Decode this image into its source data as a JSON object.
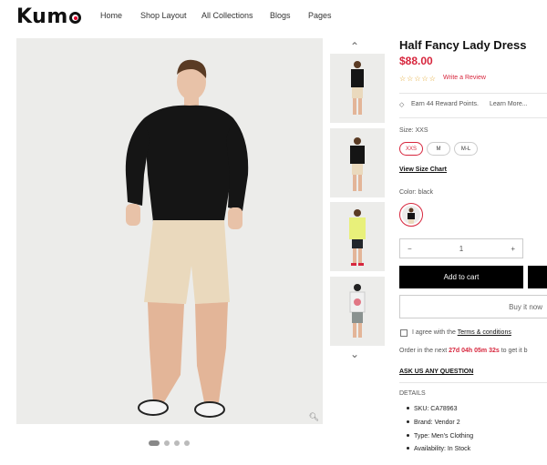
{
  "header": {
    "logo": "Kum",
    "nav": [
      "Home",
      "Shop Layout",
      "All Collections",
      "Blogs",
      "Pages"
    ]
  },
  "gallery": {
    "zoom_icon": "zoom-icon",
    "up_icon": "chevron-up-icon",
    "down_icon": "chevron-down-icon"
  },
  "product": {
    "title": "Half Fancy Lady Dress",
    "price": "$88.00",
    "stars": "☆☆☆☆☆",
    "review_link": "Write a Review",
    "reward_text": "Earn 44 Reward Points.",
    "reward_more": "Learn More...",
    "size_label": "Size: XXS",
    "sizes": [
      "XXS",
      "M",
      "M-L"
    ],
    "size_chart": "View Size Chart",
    "color_label": "Color: black",
    "quantity": "1",
    "qty_minus": "−",
    "qty_plus": "+",
    "add_to_cart": "Add to cart",
    "buy_now": "Buy it now",
    "agree_prefix": "I agree with the",
    "agree_link": "Terms & conditions",
    "order_prefix": "Order in the next",
    "countdown": "27d 04h 05m 32s",
    "order_suffix": "to get it b",
    "ask_question": "ASK US ANY QUESTION",
    "details_heading": "DETAILS",
    "details": [
      "SKU: CA78963",
      "Brand: Vendor 2",
      "Type: Men's Clothing",
      "Availability: In Stock"
    ]
  },
  "colors": {
    "accent": "#d7263d",
    "button": "#000000",
    "image_bg": "#ececea"
  }
}
